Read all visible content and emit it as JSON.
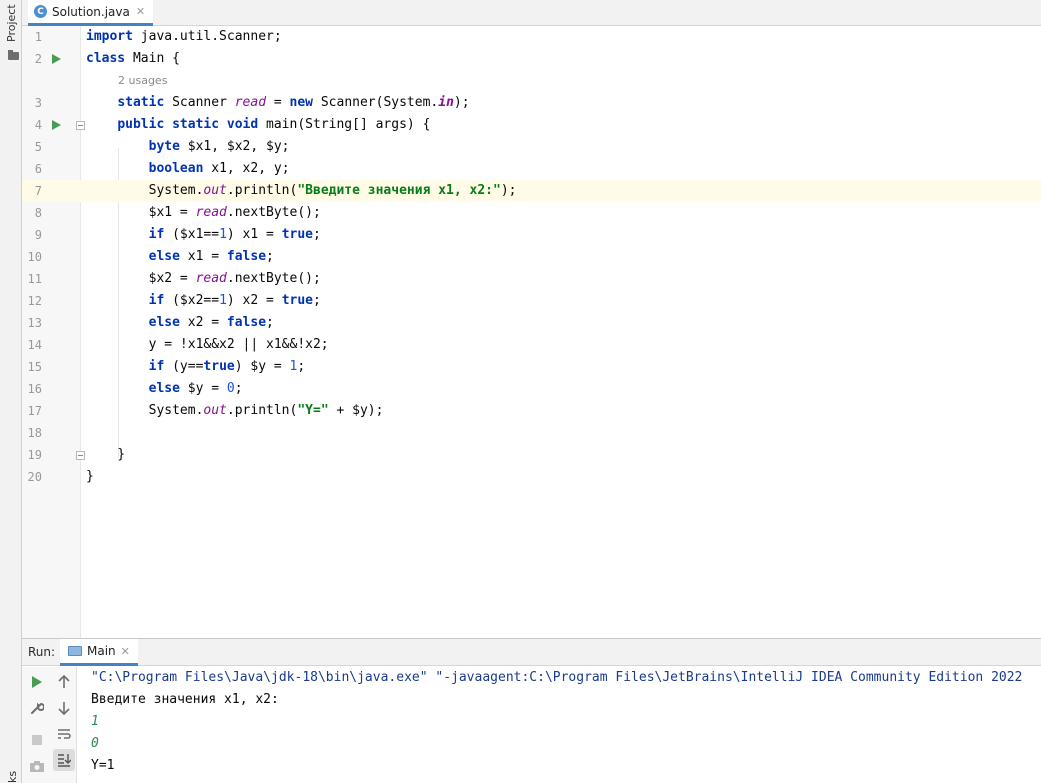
{
  "file_tab": {
    "label": "Solution.java",
    "icon_letter": "C"
  },
  "left_strip": {
    "project_label": "Project",
    "bookmarks_label": "ks"
  },
  "editor": {
    "lines": [
      "1",
      "2",
      "3",
      "4",
      "5",
      "6",
      "7",
      "8",
      "9",
      "10",
      "11",
      "12",
      "13",
      "14",
      "15",
      "16",
      "17",
      "18",
      "19",
      "20"
    ],
    "usages_hint": "2 usages"
  },
  "run_panel": {
    "label": "Run:",
    "tab_label": "Main",
    "console": {
      "command": "\"C:\\Program Files\\Java\\jdk-18\\bin\\java.exe\" \"-javaagent:C:\\Program Files\\JetBrains\\IntelliJ IDEA Community Edition 2022",
      "prompt": "Введите значения x1, x2:",
      "input1": "1",
      "input2": "0",
      "result": "Y=1"
    }
  },
  "colors": {
    "keyword": "#0033b3",
    "string": "#067d17",
    "number": "#1750eb",
    "static_field": "#871094",
    "run_green": "#499c54",
    "tab_underline": "#4083c9",
    "caret_row": "#fffbe6"
  },
  "icons": [
    "project-icon",
    "java-class-icon",
    "close-icon",
    "run-gutter-icon",
    "fold-icon",
    "rerun-icon",
    "wrench-icon",
    "stop-icon",
    "camera-icon",
    "arrow-up-icon",
    "arrow-down-icon",
    "soft-wrap-icon",
    "scroll-to-end-icon"
  ]
}
